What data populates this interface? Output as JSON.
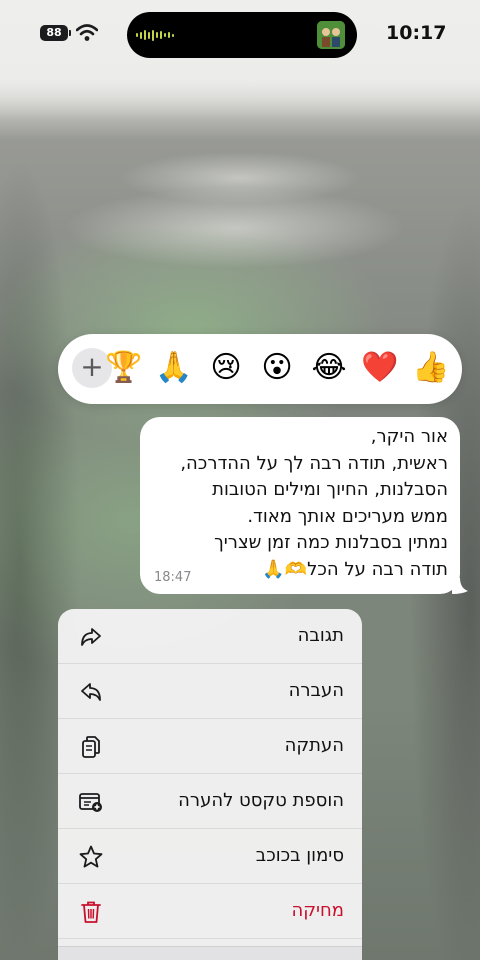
{
  "status_bar": {
    "time": "10:17",
    "battery": "88",
    "wifi_icon": "wifi-icon"
  },
  "reactions": {
    "add_icon": "+",
    "emojis": [
      "🏆",
      "🙏",
      "😢",
      "😮",
      "😂",
      "❤️",
      "👍"
    ]
  },
  "message": {
    "lines": [
      "אור היקר,",
      "ראשית, תודה רבה לך על ההדרכה,",
      "הסבלנות, החיוך ומילים הטובות",
      "ממש מעריכים אותך מאוד.",
      "נמתין בסבלנות כמה זמן שצריך",
      "תודה רבה על הכל🫶🙏"
    ],
    "time": "18:47"
  },
  "menu": {
    "items": [
      {
        "label": "תגובה",
        "icon": "reply-icon"
      },
      {
        "label": "העברה",
        "icon": "forward-icon"
      },
      {
        "label": "העתקה",
        "icon": "copy-icon"
      },
      {
        "label": "הוספת טקסט להערה",
        "icon": "add-note-icon"
      },
      {
        "label": "סימון בכוכב",
        "icon": "star-icon"
      },
      {
        "label": "מחיקה",
        "icon": "trash-icon"
      }
    ],
    "danger_color": "#c8102e"
  }
}
